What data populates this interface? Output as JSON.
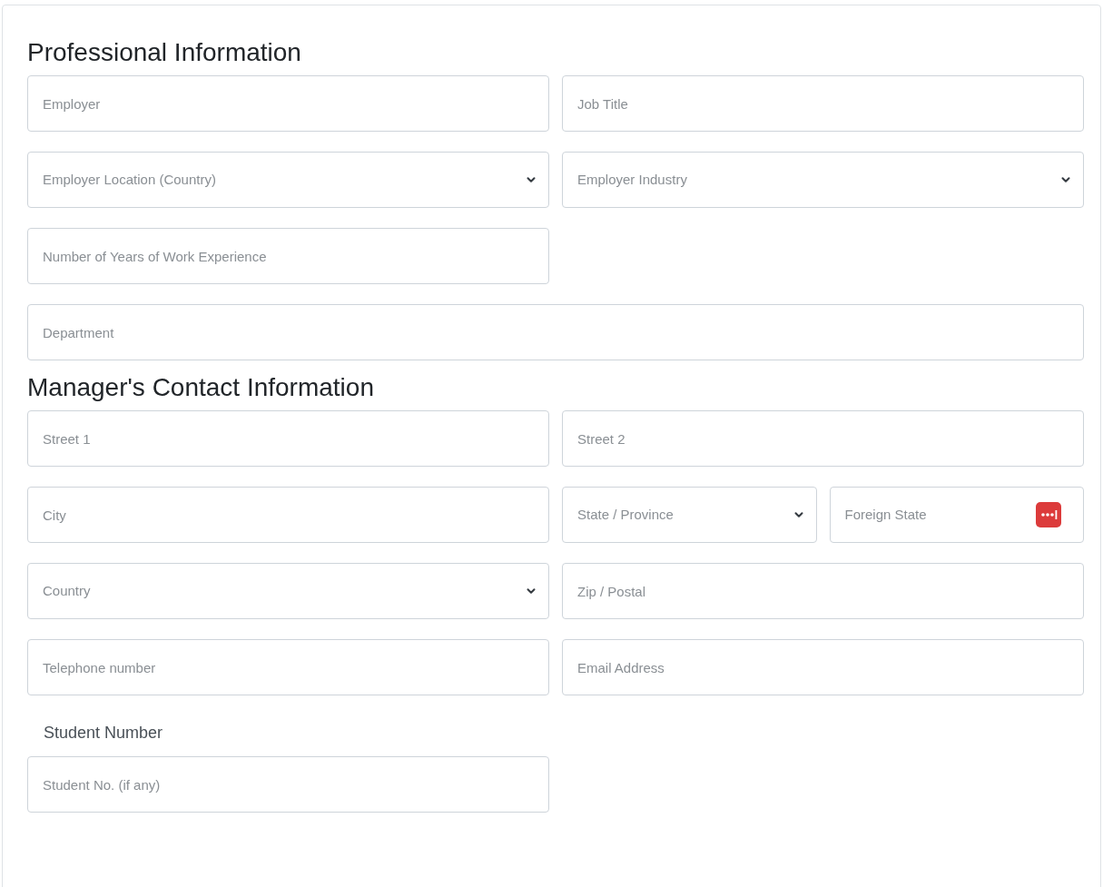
{
  "sections": [
    {
      "title": "Professional Information",
      "rows": [
        {
          "kind": "pair",
          "fields": [
            {
              "kind": "input",
              "placeholder": "Employer"
            },
            {
              "kind": "input",
              "placeholder": "Job Title"
            }
          ]
        },
        {
          "kind": "pair",
          "fields": [
            {
              "kind": "select",
              "placeholder": "Employer Location (Country)"
            },
            {
              "kind": "select",
              "placeholder": "Employer Industry"
            }
          ]
        },
        {
          "kind": "half",
          "fields": [
            {
              "kind": "input",
              "placeholder": "Number of Years of Work Experience"
            }
          ]
        },
        {
          "kind": "full",
          "fields": [
            {
              "kind": "input",
              "placeholder": "Department"
            }
          ]
        }
      ]
    },
    {
      "title": "Manager's Contact Information",
      "rows": [
        {
          "kind": "pair",
          "fields": [
            {
              "kind": "input",
              "placeholder": "Street 1"
            },
            {
              "kind": "input",
              "placeholder": "Street 2"
            }
          ]
        },
        {
          "kind": "triple",
          "fields": [
            {
              "kind": "input",
              "placeholder": "City"
            },
            {
              "kind": "select",
              "placeholder": "State / Province"
            },
            {
              "kind": "password_badge",
              "placeholder": "Foreign State"
            }
          ]
        },
        {
          "kind": "pair",
          "fields": [
            {
              "kind": "select",
              "placeholder": "Country"
            },
            {
              "kind": "input",
              "placeholder": "Zip / Postal"
            }
          ]
        },
        {
          "kind": "pair",
          "fields": [
            {
              "kind": "input",
              "placeholder": "Telephone number"
            },
            {
              "kind": "input",
              "placeholder": "Email Address"
            }
          ]
        }
      ]
    }
  ],
  "student": {
    "label": "Student Number",
    "placeholder": "Student No. (if any)"
  }
}
